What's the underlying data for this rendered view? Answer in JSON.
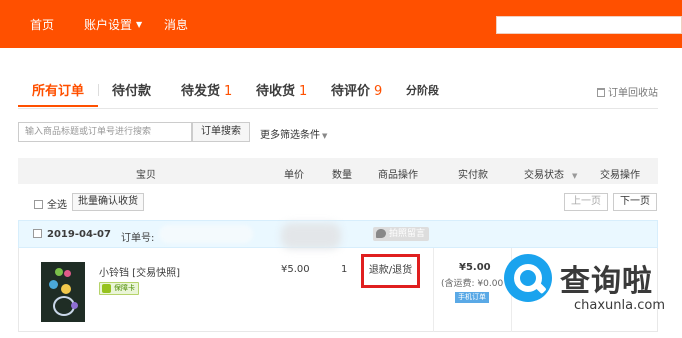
{
  "topnav": {
    "items": [
      {
        "label": "首页"
      },
      {
        "label": "账户设置",
        "has_dropdown": true
      },
      {
        "label": "消息"
      }
    ],
    "accent_color": "#ff5000"
  },
  "tabs": [
    {
      "label": "所有订单",
      "count": "",
      "active": true
    },
    {
      "label": "待付款",
      "count": ""
    },
    {
      "label": "待发货",
      "count": "1"
    },
    {
      "label": "待收货",
      "count": "1"
    },
    {
      "label": "待评价",
      "count": "9"
    },
    {
      "label": "分阶段",
      "count": ""
    }
  ],
  "recycle_label": "订单回收站",
  "search": {
    "placeholder": "输入商品标题或订单号进行搜索",
    "button_label": "订单搜索",
    "more_filters_label": "更多筛选条件"
  },
  "table": {
    "headers": [
      "宝贝",
      "单价",
      "数量",
      "商品操作",
      "实付款",
      "交易状态",
      "交易操作"
    ]
  },
  "batch": {
    "select_all_label": "全选",
    "confirm_label": "批量确认收货",
    "prev_label": "上一页",
    "next_label": "下一页"
  },
  "order": {
    "date": "2019-04-07",
    "order_no_label": "订单号: ",
    "memo_label": "拍照留言",
    "item": {
      "name": "小铃铛 [交易快照]",
      "guarantee_badge": "保障卡",
      "price": "¥5.00",
      "quantity": "1",
      "action_label": "退款/退货"
    },
    "paid": {
      "amount": "¥5.00",
      "freight": "(含运费: ¥0.00",
      "channel": "手机订单"
    }
  },
  "watermark": {
    "text": "查询啦",
    "url": "chaxunla.com"
  }
}
